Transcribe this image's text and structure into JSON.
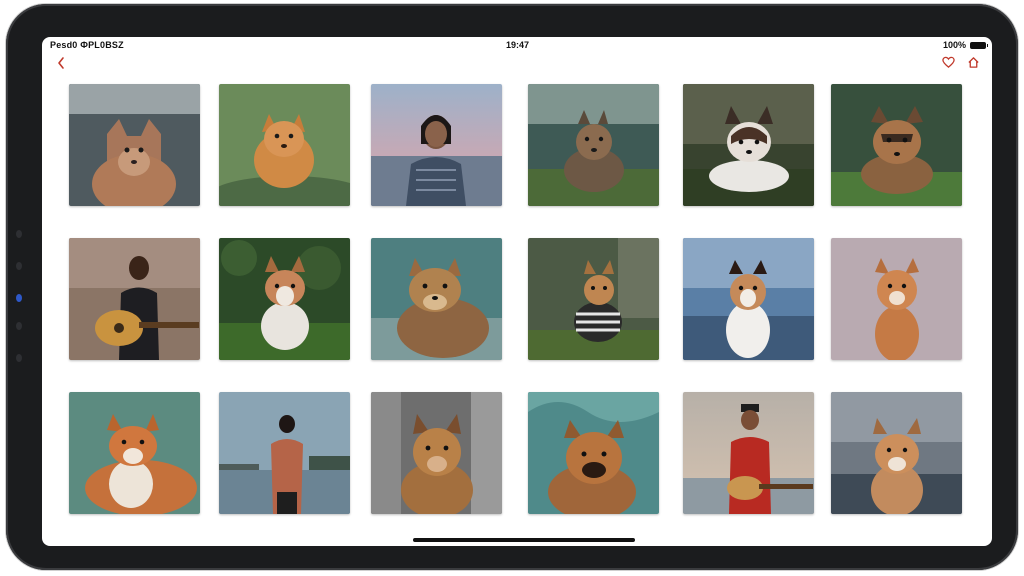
{
  "status_bar": {
    "left_text": "Pesd0 ФPL0BSZ",
    "time": "19:47",
    "battery_text": "100%"
  },
  "nav": {
    "back_icon": "chevron-left-icon",
    "right_icons": [
      "heart-icon",
      "home-icon"
    ],
    "accent": "#c0392b"
  },
  "gallery": {
    "items": [
      {
        "subject": "fox"
      },
      {
        "subject": "fox"
      },
      {
        "subject": "girl"
      },
      {
        "subject": "dog"
      },
      {
        "subject": "dog"
      },
      {
        "subject": "fox"
      },
      {
        "subject": "guitarist"
      },
      {
        "subject": "dog"
      },
      {
        "subject": "dog"
      },
      {
        "subject": "dog"
      },
      {
        "subject": "dog"
      },
      {
        "subject": "fox"
      },
      {
        "subject": "fox"
      },
      {
        "subject": "person"
      },
      {
        "subject": "dog"
      },
      {
        "subject": "dog"
      },
      {
        "subject": "guitarist"
      },
      {
        "subject": "fox"
      }
    ]
  }
}
